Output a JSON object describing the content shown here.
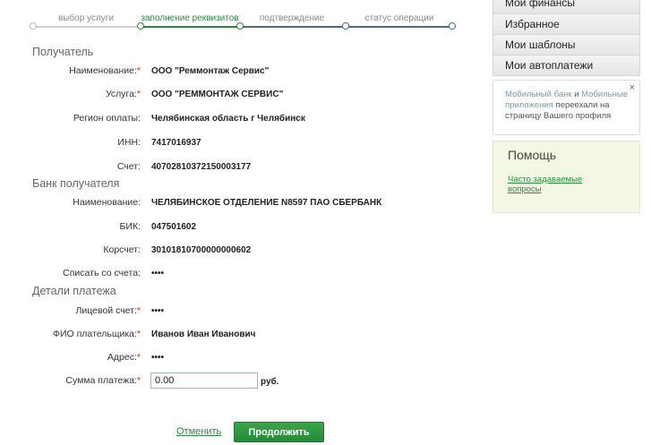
{
  "steps": [
    {
      "label": "выбор услуги",
      "state": "done"
    },
    {
      "label": "заполнение реквизитов",
      "state": "active"
    },
    {
      "label": "подтверждение",
      "state": "pending"
    },
    {
      "label": "статус операции",
      "state": "pending"
    }
  ],
  "colors": {
    "accent": "#2b8a3e",
    "pending_line": "#4a6a8a",
    "done_line": "#d0d0d0",
    "required": "#d42020"
  },
  "recipient": {
    "title": "Получатель",
    "name_label": "Наименование:",
    "name_value": "ООО \"Реммонтаж Сервис\"",
    "service_label": "Услуга:",
    "service_value": "ООО \"РЕММОНТАЖ СЕРВИС\"",
    "region_label": "Регион оплаты:",
    "region_value": "Челябинская область г Челябинск",
    "inn_label": "ИНН:",
    "inn_value": "7417016937",
    "account_label": "Счет:",
    "account_value": "40702810372150003177"
  },
  "bank": {
    "title": "Банк получателя",
    "name_label": "Наименование:",
    "name_value": "ЧЕЛЯБИНСКОЕ ОТДЕЛЕНИЕ N8597 ПАО СБЕРБАНК",
    "bik_label": "БИК:",
    "bik_value": "047501602",
    "corr_label": "Корсчет:",
    "corr_value": "30101810700000000602",
    "debit_label": "Списать со счета:",
    "debit_value": "••••"
  },
  "details": {
    "title": "Детали платежа",
    "personal_label": "Лицевой счет:",
    "personal_value": "••••",
    "payer_label": "ФИО плательщика:",
    "payer_value": "Иванов Иван Иванович",
    "address_label": "Адрес:",
    "address_value": "••••",
    "amount_label": "Сумма платежа:",
    "amount_value": "0.00",
    "amount_unit": "руб."
  },
  "actions": {
    "cancel": "Отменить",
    "continue": "Продолжить"
  },
  "sidebar": {
    "menu": [
      "Мои финансы",
      "Избранное",
      "Мои шаблоны",
      "Мои автоплатежи"
    ],
    "notice": {
      "close": "×",
      "link1": "Мобильный банк",
      "and": " и ",
      "link2": "Мобильные приложения",
      "text": " переехали на страницу Вашего профиля"
    },
    "help": {
      "title": "Помощь",
      "faq": "Часто задаваемые вопросы"
    }
  }
}
